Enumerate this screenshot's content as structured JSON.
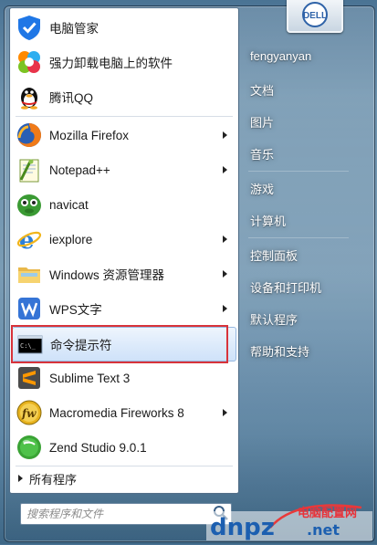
{
  "left_panel": {
    "pinned": [
      {
        "label": "电脑管家",
        "icon": "tencent-pc-manager-icon"
      },
      {
        "label": "强力卸载电脑上的软件",
        "icon": "uninstaller-icon"
      },
      {
        "label": "腾讯QQ",
        "icon": "qq-penguin-icon"
      }
    ],
    "recent": [
      {
        "label": "Mozilla Firefox",
        "icon": "firefox-icon",
        "has_submenu": true
      },
      {
        "label": "Notepad++",
        "icon": "notepad-plus-plus-icon",
        "has_submenu": true
      },
      {
        "label": "navicat",
        "icon": "navicat-icon",
        "has_submenu": false
      },
      {
        "label": "iexplore",
        "icon": "internet-explorer-icon",
        "has_submenu": true
      },
      {
        "label": "Windows 资源管理器",
        "icon": "windows-explorer-icon",
        "has_submenu": true
      },
      {
        "label": "WPS文字",
        "icon": "wps-writer-icon",
        "has_submenu": true
      },
      {
        "label": "命令提示符",
        "icon": "command-prompt-icon",
        "has_submenu": false,
        "highlighted": true
      },
      {
        "label": "Sublime Text 3",
        "icon": "sublime-text-icon",
        "has_submenu": false
      },
      {
        "label": "Macromedia Fireworks 8",
        "icon": "fireworks-icon",
        "has_submenu": true
      },
      {
        "label": "Zend Studio 9.0.1",
        "icon": "zend-studio-icon",
        "has_submenu": false
      }
    ],
    "all_programs": "所有程序",
    "search_placeholder": "搜索程序和文件"
  },
  "right_panel": {
    "user_name": "fengyanyan",
    "avatar_brand": "DELL",
    "items": [
      "文档",
      "图片",
      "音乐",
      "游戏",
      "计算机",
      "控制面板",
      "设备和打印机",
      "默认程序",
      "帮助和支持"
    ]
  },
  "watermark": {
    "text_main": "dnpz",
    "text_domain": ".net",
    "text_cn": "电脑配置网"
  },
  "colors": {
    "highlight_border": "#d8333a",
    "selection_fill": "#dceafb",
    "panel_bg": "#ffffff",
    "aero_blue": "#6d92ad"
  }
}
